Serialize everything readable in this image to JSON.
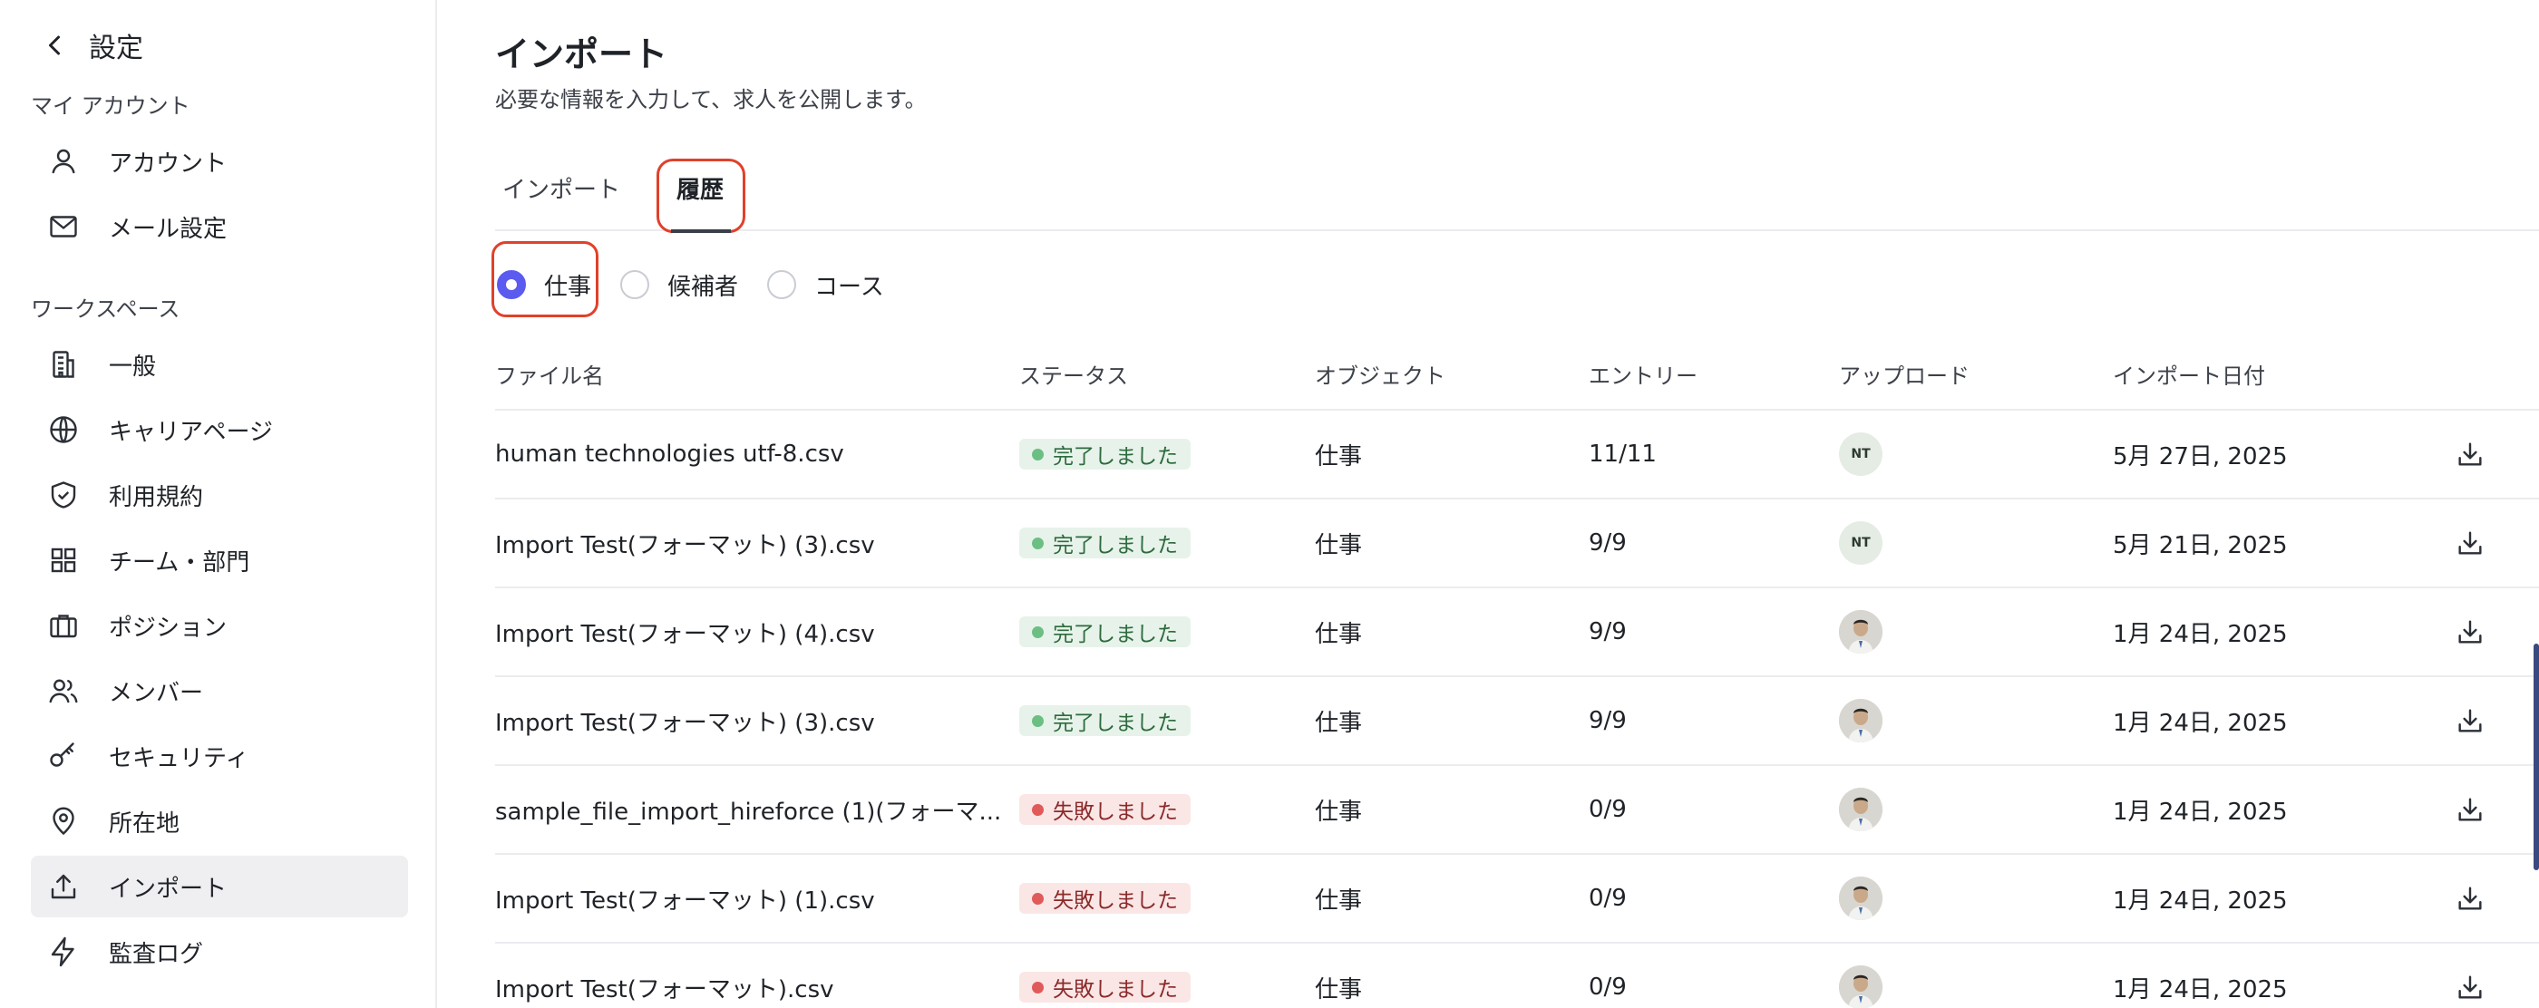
{
  "sidebar": {
    "back_title": "設定",
    "section_account": "マイ アカウント",
    "account_items": [
      {
        "label": "アカウント",
        "icon": "user-icon"
      },
      {
        "label": "メール設定",
        "icon": "mail-icon"
      }
    ],
    "section_workspace": "ワークスペース",
    "workspace_items": [
      {
        "label": "一般",
        "icon": "building-icon"
      },
      {
        "label": "キャリアページ",
        "icon": "globe-icon"
      },
      {
        "label": "利用規約",
        "icon": "shield-check-icon"
      },
      {
        "label": "チーム・部門",
        "icon": "grid-icon"
      },
      {
        "label": "ポジション",
        "icon": "briefcase-icon"
      },
      {
        "label": "メンバー",
        "icon": "users-icon"
      },
      {
        "label": "セキュリティ",
        "icon": "key-icon"
      },
      {
        "label": "所在地",
        "icon": "map-pin-icon"
      },
      {
        "label": "インポート",
        "icon": "upload-icon",
        "active": true
      },
      {
        "label": "監査ログ",
        "icon": "bolt-icon"
      }
    ]
  },
  "main": {
    "title": "インポート",
    "subtitle": "必要な情報を入力して、求人を公開します。",
    "tabs": [
      {
        "label": "インポート",
        "active": false
      },
      {
        "label": "履歴",
        "active": true
      }
    ],
    "radios": [
      {
        "label": "仕事",
        "checked": true
      },
      {
        "label": "候補者",
        "checked": false
      },
      {
        "label": "コース",
        "checked": false
      }
    ],
    "columns": [
      "ファイル名",
      "ステータス",
      "オブジェクト",
      "エントリー",
      "アップロード",
      "インポート日付"
    ],
    "rows": [
      {
        "file": "human technologies utf-8.csv",
        "status": "完了しました",
        "status_type": "ok",
        "object": "仕事",
        "entries": "11/11",
        "uploader": "NT",
        "date": "5月 27日, 2025"
      },
      {
        "file": "Import Test(フォーマット) (3).csv",
        "status": "完了しました",
        "status_type": "ok",
        "object": "仕事",
        "entries": "9/9",
        "uploader": "NT",
        "date": "5月 21日, 2025"
      },
      {
        "file": "Import Test(フォーマット) (4).csv",
        "status": "完了しました",
        "status_type": "ok",
        "object": "仕事",
        "entries": "9/9",
        "uploader": "",
        "date": "1月 24日, 2025"
      },
      {
        "file": "Import Test(フォーマット) (3).csv",
        "status": "完了しました",
        "status_type": "ok",
        "object": "仕事",
        "entries": "9/9",
        "uploader": "",
        "date": "1月 24日, 2025"
      },
      {
        "file": "sample_file_import_hireforce (1)(フォーマ...",
        "status": "失敗しました",
        "status_type": "fail",
        "object": "仕事",
        "entries": "0/9",
        "uploader": "",
        "date": "1月 24日, 2025"
      },
      {
        "file": "Import Test(フォーマット) (1).csv",
        "status": "失敗しました",
        "status_type": "fail",
        "object": "仕事",
        "entries": "0/9",
        "uploader": "",
        "date": "1月 24日, 2025"
      },
      {
        "file": "Import Test(フォーマット).csv",
        "status": "失敗しました",
        "status_type": "fail",
        "object": "仕事",
        "entries": "0/9",
        "uploader": "",
        "date": "1月 24日, 2025"
      }
    ]
  }
}
